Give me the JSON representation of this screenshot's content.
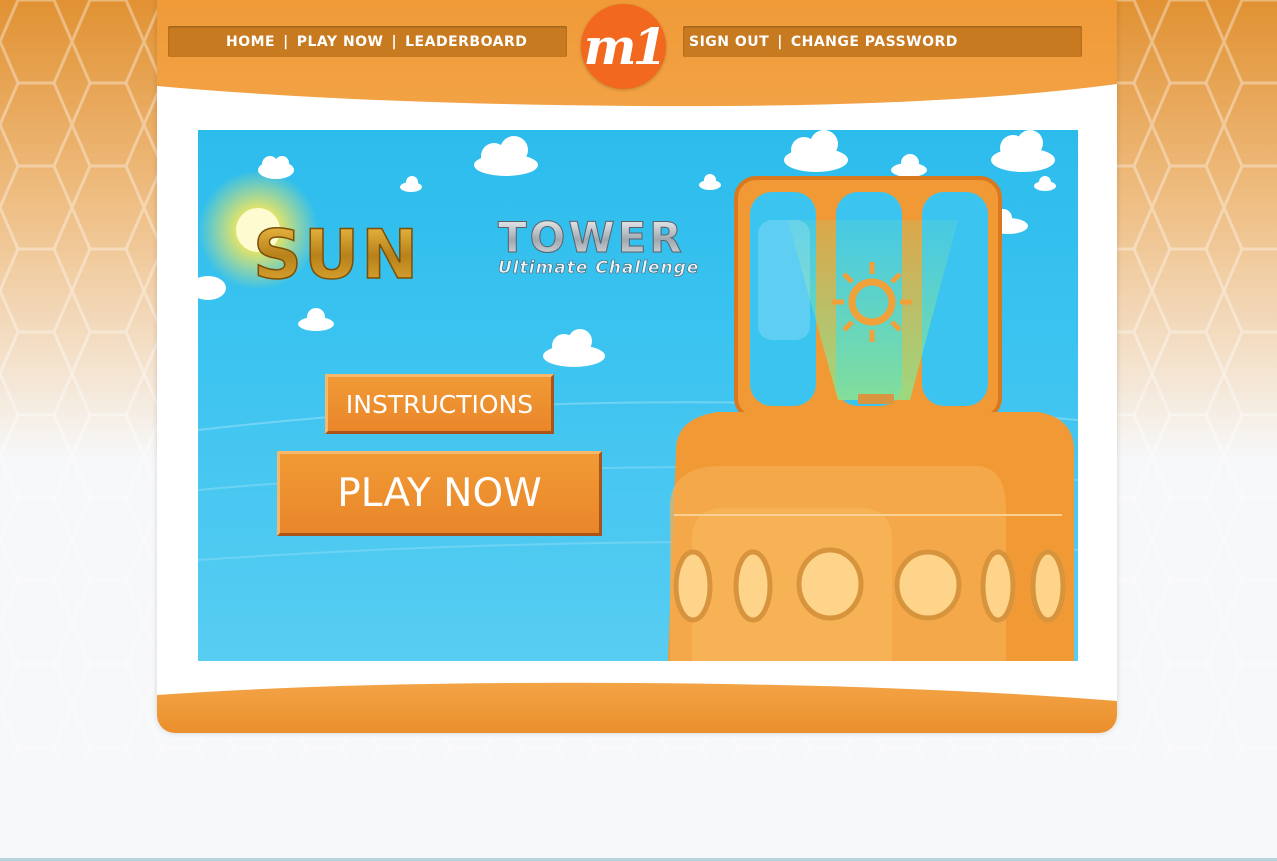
{
  "nav": {
    "left": [
      {
        "label": "HOME"
      },
      {
        "label": "PLAY NOW"
      },
      {
        "label": "LEADERBOARD"
      }
    ],
    "right": [
      {
        "label": "SIGN OUT"
      },
      {
        "label": "CHANGE PASSWORD"
      }
    ],
    "separator": "|"
  },
  "logo": {
    "text": "m1"
  },
  "game": {
    "title_word1": "SUN",
    "title_word2": "TOWER",
    "subtitle": "Ultimate Challenge",
    "instructions_button": "INSTRUCTIONS",
    "play_button": "PLAY NOW"
  },
  "colors": {
    "brand_orange": "#f1681e",
    "nav_bar": "#c87a20",
    "button_orange": "#ec8c2c",
    "sky": "#3bc3f0",
    "tower": "#f19a35"
  },
  "icons": {
    "sun": "sun-icon",
    "clouds": "cloud-icon"
  }
}
